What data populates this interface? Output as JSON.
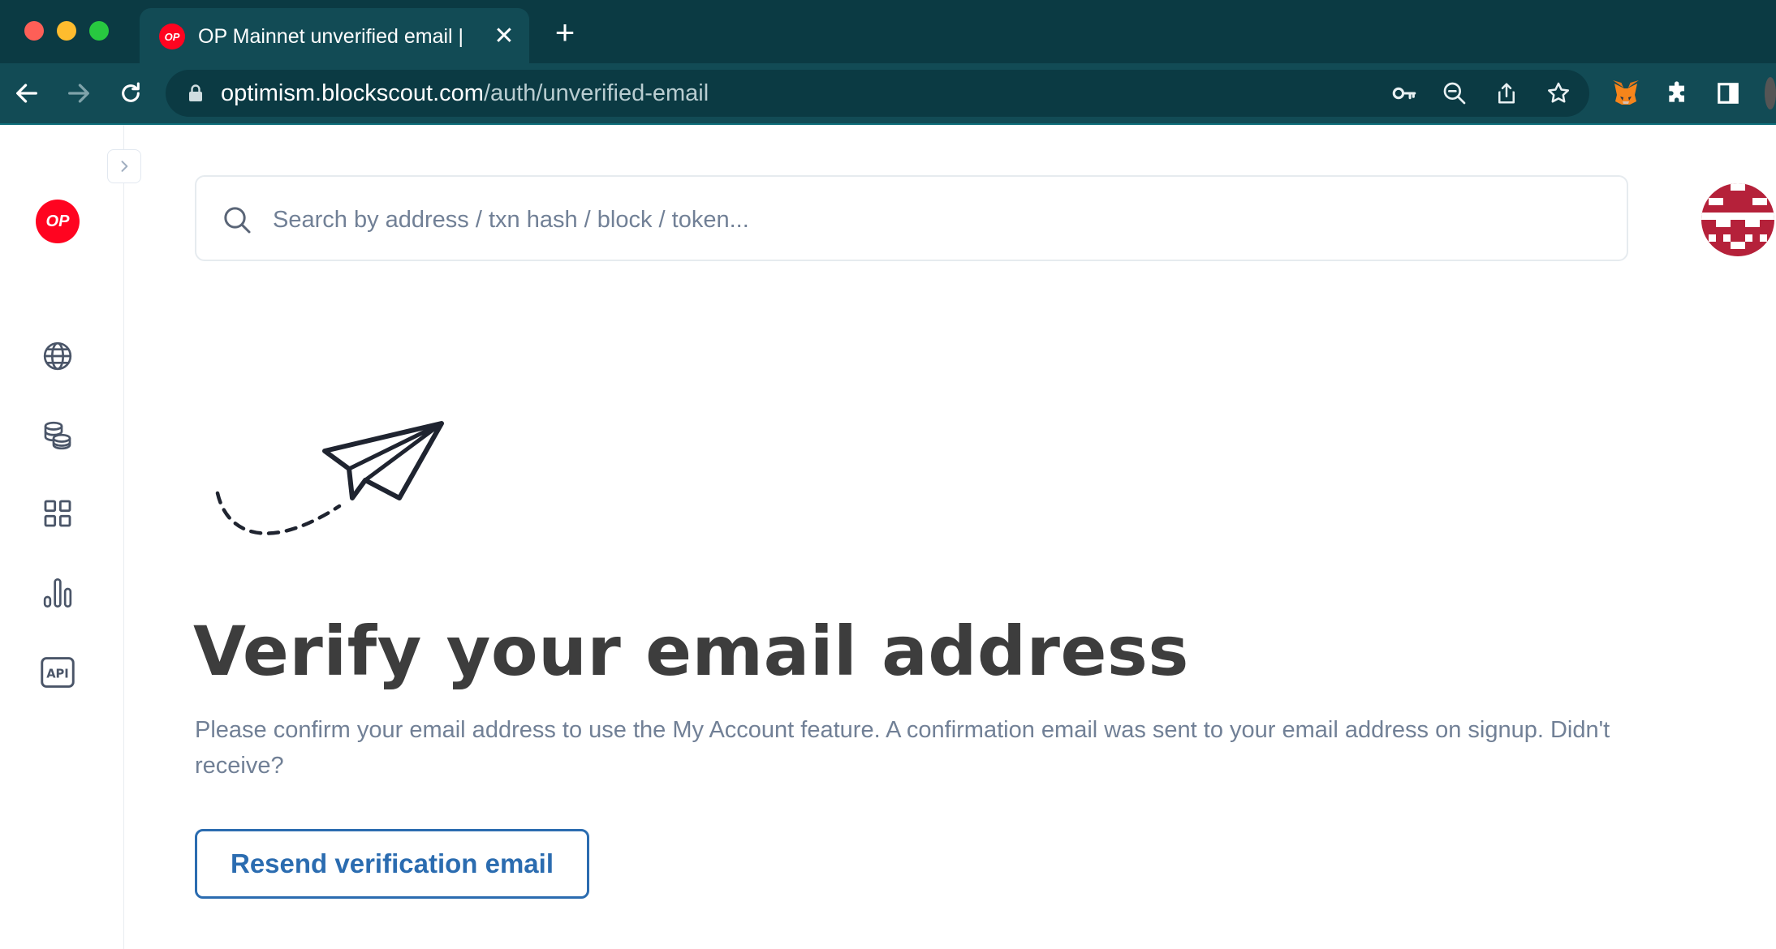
{
  "browser": {
    "tab_title": "OP Mainnet unverified email | Blockscout",
    "tab_favicon_text": "OP",
    "url_host": "optimism.blockscout.com",
    "url_path": "/auth/unverified-email"
  },
  "sidebar": {
    "logo_text": "OP",
    "items": [
      {
        "icon": "globe-icon"
      },
      {
        "icon": "coins-icon"
      },
      {
        "icon": "apps-grid-icon"
      },
      {
        "icon": "stats-chart-icon"
      },
      {
        "icon": "api-icon",
        "text": "API"
      }
    ]
  },
  "search": {
    "placeholder": "Search by address / txn hash / block / token..."
  },
  "main": {
    "title": "Verify your email address",
    "description": "Please confirm your email address to use the My Account feature. A confirmation email was sent to your email address on signup. Didn't receive?",
    "resend_button": "Resend verification email"
  },
  "colors": {
    "chrome_dark": "#0b3a43",
    "chrome_toolbar": "#124b55",
    "brand_red": "#ff0420",
    "link_blue": "#2b6cb0",
    "heading": "#3d3d3d",
    "muted_text": "#718096",
    "avatar_red": "#b5213a"
  }
}
